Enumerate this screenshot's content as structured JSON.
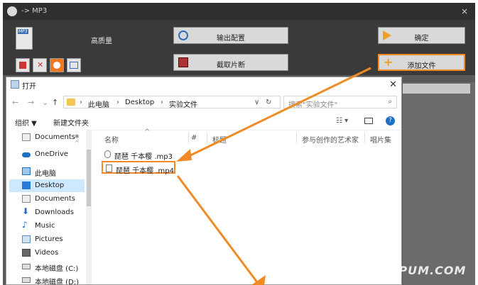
{
  "app": {
    "title": "-> MP3",
    "close_glyph": "×",
    "quality_label": "高质量",
    "output_config_label": "输出配置",
    "clip_label": "截取片断",
    "confirm_label": "确定",
    "add_file_label": "添加文件",
    "file_icon_text": "MP3"
  },
  "dialog": {
    "title": "打开",
    "close_glyph": "✕",
    "nav": {
      "back": "←",
      "forward": "→",
      "down": "⌄",
      "up": "↑"
    },
    "breadcrumb": [
      "此电脑",
      "Desktop",
      "实验文件"
    ],
    "breadcrumb_sep": "›",
    "path_dropdown": "∨",
    "refresh": "↻",
    "search_placeholder": "搜索\"实验文件\"",
    "search_glyph": "⌕",
    "organize_label": "组织 ▼",
    "new_folder_label": "新建文件夹",
    "view_glyph": "☷ ▾",
    "help_glyph": "?",
    "nav_items": [
      {
        "label": "Documents",
        "pin": "✱ ^",
        "icon": "documents-icon"
      },
      {
        "label": "OneDrive",
        "icon": "cloud-icon"
      },
      {
        "label": "此电脑",
        "icon": "computer-icon"
      },
      {
        "label": "Desktop",
        "icon": "desktop-icon",
        "selected": true
      },
      {
        "label": "Documents",
        "icon": "documents-icon"
      },
      {
        "label": "Downloads",
        "icon": "download-icon"
      },
      {
        "label": "Music",
        "icon": "music-icon"
      },
      {
        "label": "Pictures",
        "icon": "pictures-icon"
      },
      {
        "label": "Videos",
        "icon": "videos-icon"
      },
      {
        "label": "本地磁盘 (C:)",
        "icon": "drive-icon"
      },
      {
        "label": "本地磁盘 (D:)",
        "icon": "drive-icon"
      }
    ],
    "columns": {
      "name": "名称",
      "sort_glyph": "^",
      "number": "#",
      "title": "标题",
      "artists": "参与创作的艺术家",
      "album": "唱片集"
    },
    "files": [
      {
        "name": "琵琶 千本樱 .mp3"
      },
      {
        "name": "琵琶 千本樱 .mp4",
        "highlighted": true
      }
    ]
  },
  "watermark": "APUM.COM",
  "colors": {
    "accent": "#f08a24",
    "selection": "#cde8ff",
    "help": "#1f6fc5",
    "app_bg": "#3a3a3a"
  }
}
